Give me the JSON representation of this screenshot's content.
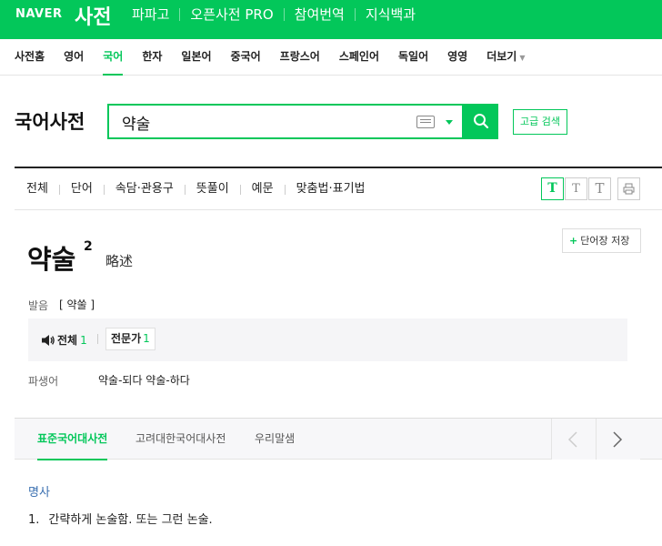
{
  "header": {
    "logo": "NAVER",
    "service": "사전",
    "nav": [
      "파파고",
      "오픈사전 PRO",
      "참여번역",
      "지식백과"
    ]
  },
  "langnav": {
    "items": [
      "사전홈",
      "영어",
      "국어",
      "한자",
      "일본어",
      "중국어",
      "프랑스어",
      "스페인어",
      "독일어",
      "영영",
      "더보기"
    ],
    "active": "국어"
  },
  "search": {
    "dict_title": "국어사전",
    "query": "약술",
    "advanced_label": "고급 검색"
  },
  "filters": {
    "items": [
      "전체",
      "단어",
      "속담·관용구",
      "뜻풀이",
      "예문",
      "맞춤법·표기법"
    ],
    "font_size_glyph": "T"
  },
  "entry": {
    "save_label": "단어장 저장",
    "headword": "약술",
    "homonym_number": "2",
    "hanja": "略述",
    "pron_label": "발음",
    "pron_value": "[ 약쑬 ]",
    "audio_all_label": "전체",
    "audio_all_count": "1",
    "audio_expert_label": "전문가",
    "audio_expert_count": "1",
    "derivative_label": "파생어",
    "derivative_value": "약술-되다 약술-하다"
  },
  "dict_tabs": {
    "items": [
      "표준국어대사전",
      "고려대한국어대사전",
      "우리말샘"
    ],
    "active": "표준국어대사전"
  },
  "definition": {
    "pos": "명사",
    "num": "1.",
    "text": "간략하게 논술함. 또는 그런 논술."
  },
  "colors": {
    "brand": "#03c75a",
    "pos_blue": "#3a6fb0"
  }
}
